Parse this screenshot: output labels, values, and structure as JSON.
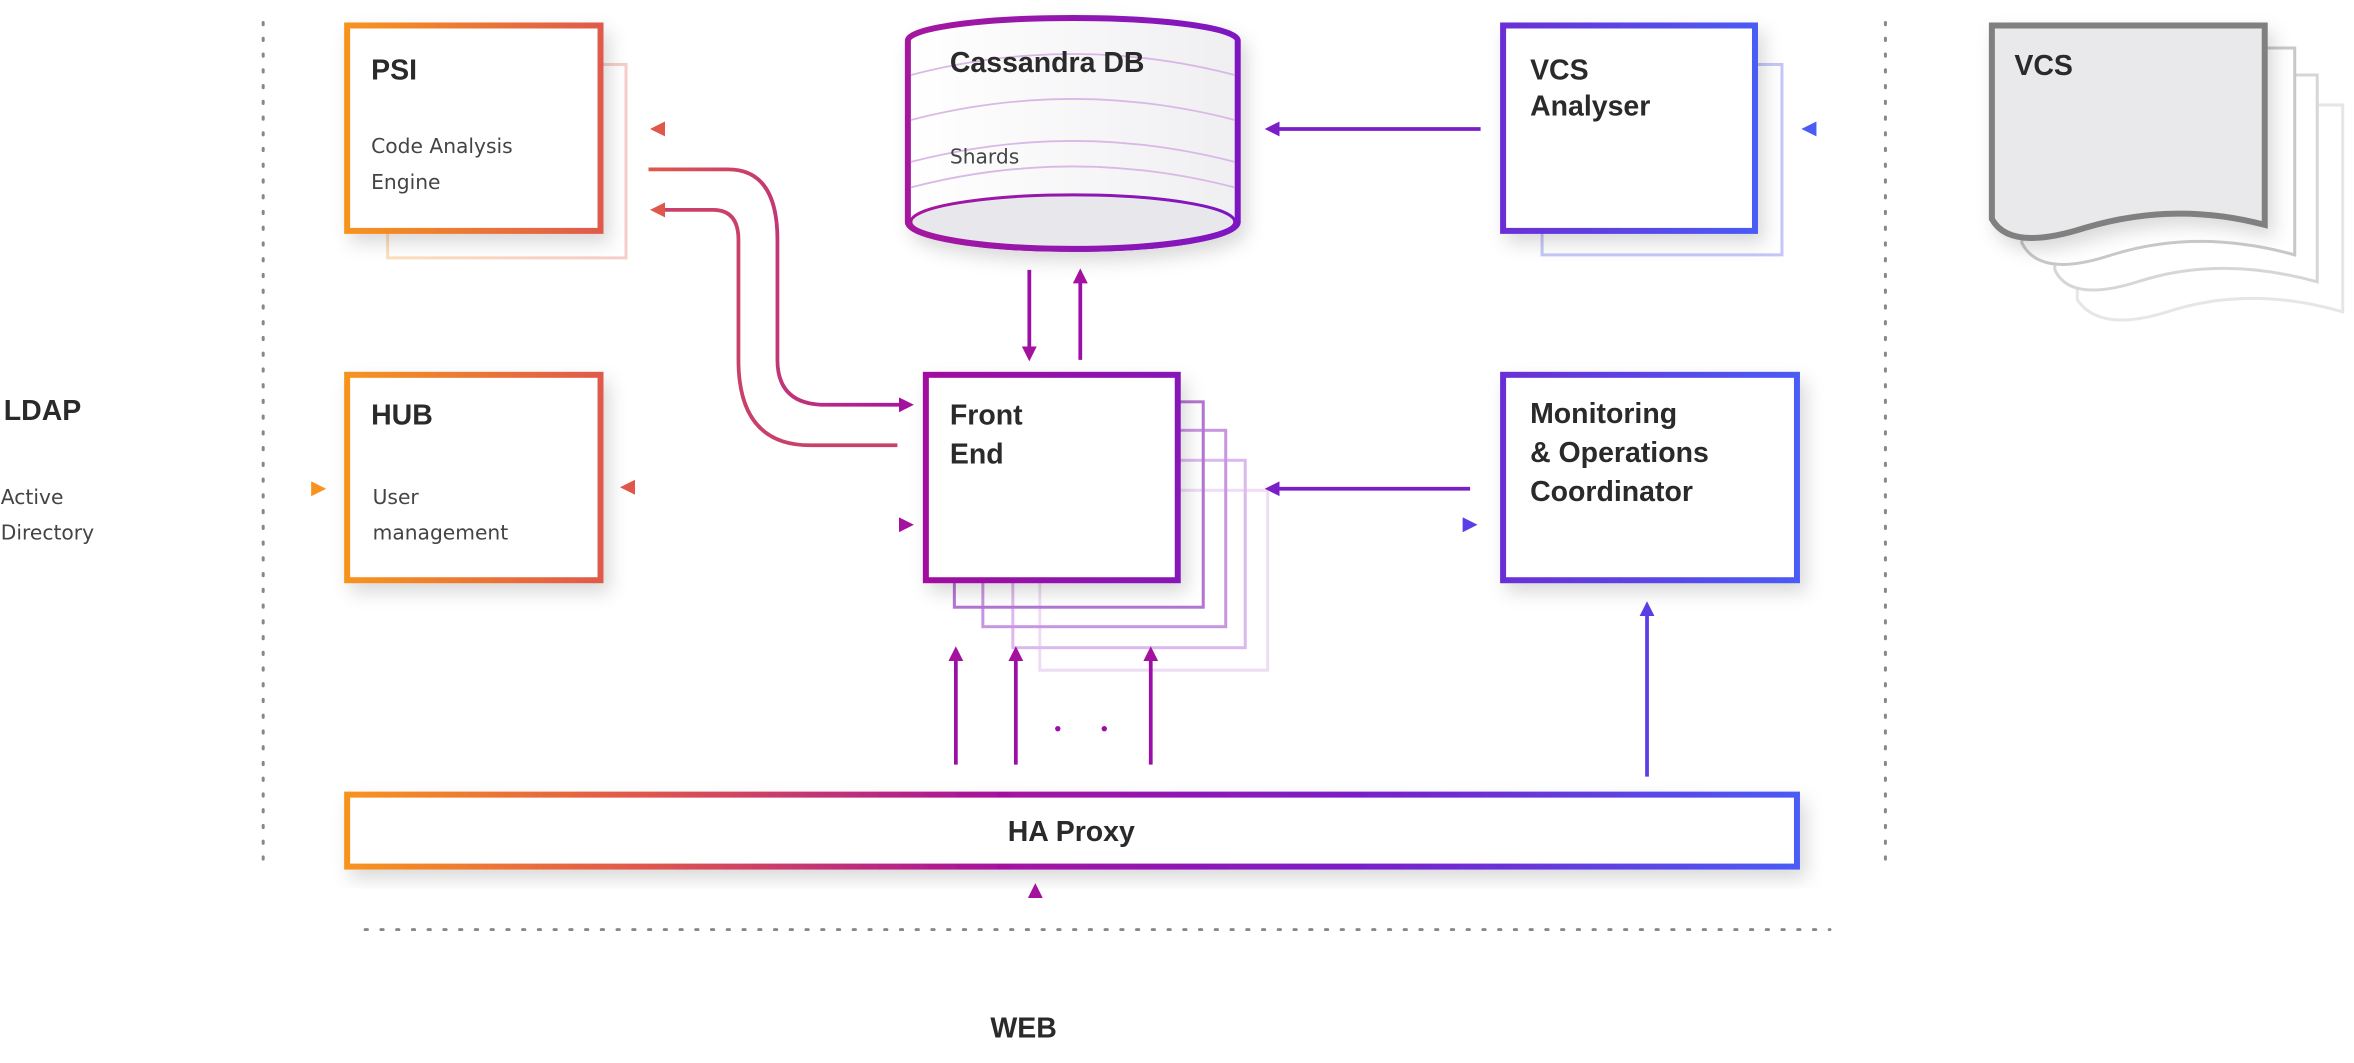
{
  "nodes": {
    "psi": {
      "title": "PSI",
      "subtitle_line1": "Code Analysis",
      "subtitle_line2": "Engine"
    },
    "cassandra": {
      "title": "Cassandra DB",
      "subtitle": "Shards"
    },
    "vcs_analyser": {
      "title_line1": "VCS",
      "title_line2": "Analyser"
    },
    "vcs": {
      "title": "VCS"
    },
    "hub": {
      "title": "HUB",
      "subtitle_line1": "User",
      "subtitle_line2": "management"
    },
    "front_end": {
      "title_line1": "Front",
      "title_line2": "End"
    },
    "monitoring": {
      "title_line1": "Monitoring",
      "title_line2": "& Operations",
      "title_line3": "Coordinator"
    },
    "ha_proxy": {
      "title": "HA Proxy"
    },
    "ldap": {
      "title": "LDAP",
      "subtitle_line1": "Active",
      "subtitle_line2": "Directory"
    },
    "web": {
      "title": "WEB"
    }
  },
  "colors": {
    "orange": "#f7931e",
    "coral": "#e0584a",
    "magenta": "#9b0fa8",
    "purple": "#7a1fc8",
    "blue": "#4b5bf5",
    "gray": "#808080",
    "text": "#2a2a2a"
  }
}
